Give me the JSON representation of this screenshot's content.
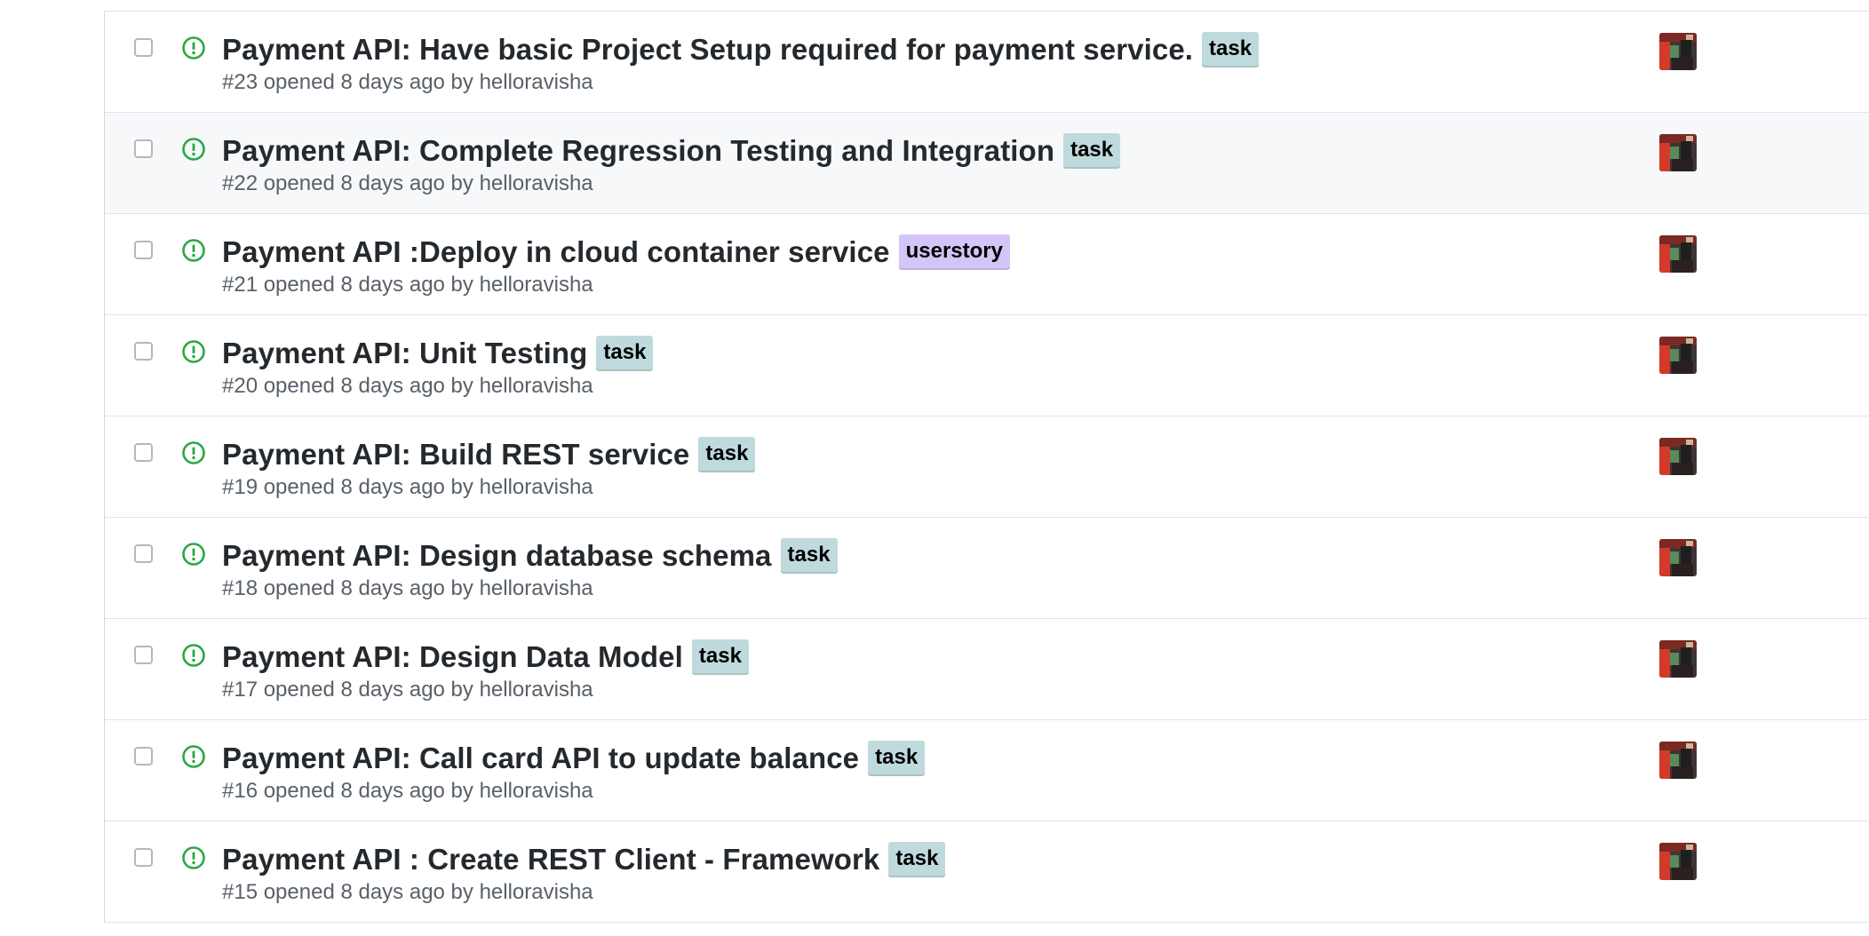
{
  "issues": [
    {
      "title": "Payment API: Have basic Project Setup required for payment service.",
      "label": "task",
      "meta": "#23 opened 8 days ago by helloravisha",
      "label_color": "#bfdadc"
    },
    {
      "title": "Payment API: Complete Regression Testing and Integration",
      "label": "task",
      "meta": "#22 opened 8 days ago by helloravisha",
      "label_color": "#bfdadc"
    },
    {
      "title": "Payment API :Deploy in cloud container service",
      "label": "userstory",
      "meta": "#21 opened 8 days ago by helloravisha",
      "label_color": "#d4c5f9"
    },
    {
      "title": "Payment API: Unit Testing",
      "label": "task",
      "meta": "#20 opened 8 days ago by helloravisha",
      "label_color": "#bfdadc"
    },
    {
      "title": "Payment API: Build REST service",
      "label": "task",
      "meta": "#19 opened 8 days ago by helloravisha",
      "label_color": "#bfdadc"
    },
    {
      "title": "Payment API: Design database schema",
      "label": "task",
      "meta": "#18 opened 8 days ago by helloravisha",
      "label_color": "#bfdadc"
    },
    {
      "title": "Payment API: Design Data Model",
      "label": "task",
      "meta": "#17 opened 8 days ago by helloravisha",
      "label_color": "#bfdadc"
    },
    {
      "title": "Payment API: Call card API to update balance",
      "label": "task",
      "meta": "#16 opened 8 days ago by helloravisha",
      "label_color": "#bfdadc"
    },
    {
      "title": "Payment API : Create REST Client - Framework",
      "label": "task",
      "meta": "#15 opened 8 days ago by helloravisha",
      "label_color": "#bfdadc"
    }
  ],
  "colors": {
    "open_icon": "#28a745",
    "task_label": "#bfdadc",
    "userstory_label": "#d4c5f9",
    "hover_row": "#f6f8fa"
  }
}
